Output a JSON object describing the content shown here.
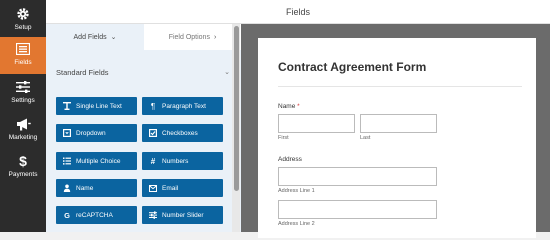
{
  "sidebar": {
    "items": [
      {
        "label": "Setup",
        "icon": "gear-icon",
        "active": false
      },
      {
        "label": "Fields",
        "icon": "list-icon",
        "active": true
      },
      {
        "label": "Settings",
        "icon": "sliders-icon",
        "active": false
      },
      {
        "label": "Marketing",
        "icon": "megaphone-icon",
        "active": false
      },
      {
        "label": "Payments",
        "icon": "dollar-icon",
        "active": false
      }
    ],
    "colors": {
      "background": "#2c2c2c",
      "active": "#e27730"
    }
  },
  "header": {
    "title": "Fields"
  },
  "panel": {
    "tabs": [
      {
        "label": "Add Fields",
        "chevron": "chevron-down-icon"
      },
      {
        "label": "Field Options",
        "chevron": "chevron-right-icon"
      }
    ],
    "section": "Standard Fields",
    "field_buttons": [
      {
        "label": "Single Line Text",
        "icon": "text-icon"
      },
      {
        "label": "Paragraph Text",
        "icon": "paragraph-icon"
      },
      {
        "label": "Dropdown",
        "icon": "dropdown-icon"
      },
      {
        "label": "Checkboxes",
        "icon": "checkbox-icon"
      },
      {
        "label": "Multiple Choice",
        "icon": "list-icon"
      },
      {
        "label": "Numbers",
        "icon": "hash-icon"
      },
      {
        "label": "Name",
        "icon": "user-icon"
      },
      {
        "label": "Email",
        "icon": "envelope-icon"
      },
      {
        "label": "reCAPTCHA",
        "icon": "google-icon"
      },
      {
        "label": "Number Slider",
        "icon": "slider-icon"
      }
    ],
    "button_color": "#0b64a0"
  },
  "form": {
    "title": "Contract Agreement Form",
    "name_label": "Name",
    "required_mark": "*",
    "first_label": "First",
    "last_label": "Last",
    "address_label": "Address",
    "address_line1": "Address Line 1",
    "address_line2": "Address Line 2"
  }
}
